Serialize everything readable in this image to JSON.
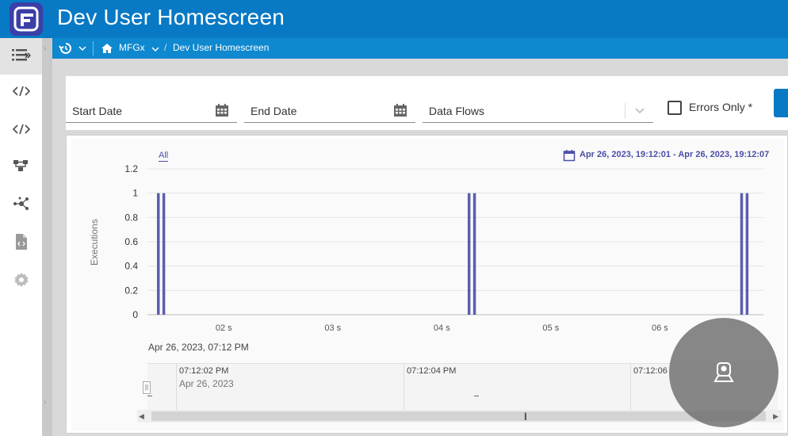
{
  "app": {
    "title": "Dev User Homescreen"
  },
  "breadcrumb": {
    "root": "MFGx",
    "separator": "/",
    "current": "Dev User Homescreen"
  },
  "sidebar": {
    "items": [
      {
        "icon": "list-expand-icon"
      },
      {
        "icon": "code-icon"
      },
      {
        "icon": "code-icon"
      },
      {
        "icon": "hierarchy-icon"
      },
      {
        "icon": "network-icon"
      },
      {
        "icon": "code-file-icon"
      },
      {
        "icon": "gear-icon"
      }
    ]
  },
  "filters": {
    "start_date": {
      "label": "Start Date"
    },
    "end_date": {
      "label": "End Date"
    },
    "data_flows": {
      "label": "Data Flows"
    },
    "errors_only": {
      "label": "Errors Only *",
      "checked": false
    }
  },
  "chart_panel": {
    "tab_all": "All",
    "date_range": "Apr 26, 2023, 19:12:01 - Apr 26, 2023, 19:12:07",
    "date_under_axis": "Apr 26, 2023, 07:12 PM",
    "navigator": {
      "labels": [
        "07:12:02 PM",
        "07:12:04 PM",
        "07:12:06"
      ],
      "sub_label": "Apr 26, 2023"
    }
  },
  "chart_data": {
    "type": "bar",
    "ylabel": "Executions",
    "xlabel": "",
    "ylim": [
      0,
      1.2
    ],
    "yticks": [
      "1.2",
      "1",
      "0.8",
      "0.6",
      "0.4",
      "0.2",
      "0"
    ],
    "xticks": [
      "02 s",
      "03 s",
      "04 s",
      "05 s",
      "06 s"
    ],
    "grid": true,
    "color": "#5b5fae",
    "x_seconds": [
      1.4,
      1.45,
      4.25,
      4.3,
      6.75,
      6.8
    ],
    "values": [
      1,
      1,
      1,
      1,
      1,
      1
    ]
  },
  "colors": {
    "header": "#0879c4",
    "breadcrumb_bar": "#0e88cf",
    "logo": "#3b3fa7",
    "accent": "#4b4ea8"
  }
}
